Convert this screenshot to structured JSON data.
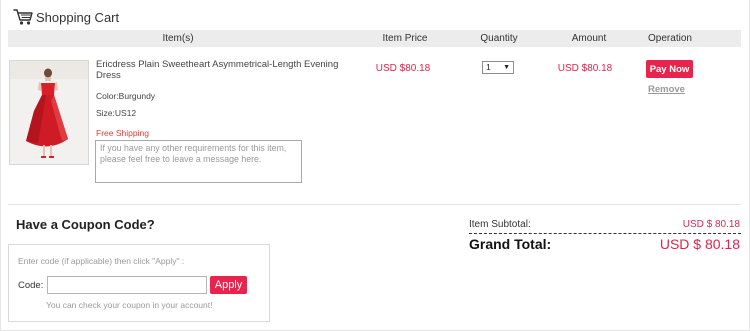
{
  "header": {
    "title": "Shopping Cart",
    "icon": "cart-icon"
  },
  "columns": {
    "items": "Item(s)",
    "price": "Item Price",
    "quantity": "Quantity",
    "amount": "Amount",
    "operation": "Operation"
  },
  "cart_item": {
    "name": "Ericdress Plain Sweetheart Asymmetrical-Length Evening Dress",
    "color": "Color:Burgundy",
    "size": "Size:US12",
    "shipping": "Free Shipping",
    "message_placeholder": "If you have any other requirements for this item, please feel free to leave a message here.",
    "price": "USD $80.18",
    "quantity": "1",
    "amount": "USD $80.18",
    "pay_label": "Pay Now",
    "remove_label": "Remove"
  },
  "coupon": {
    "title": "Have a Coupon Code?",
    "hint": "Enter code (if applicable) then click \"Apply\" :",
    "code_label": "Code:",
    "code_value": "",
    "apply_label": "Apply",
    "note": "You can check your coupon in your account!"
  },
  "totals": {
    "subtotal_label": "Item Subtotal:",
    "subtotal_value": "USD $ 80.18",
    "grand_label": "Grand Total:",
    "grand_value": "USD $ 80.18"
  },
  "colors": {
    "accent": "#e8244c",
    "price": "#e0244c",
    "header_bar": "#ececec"
  }
}
